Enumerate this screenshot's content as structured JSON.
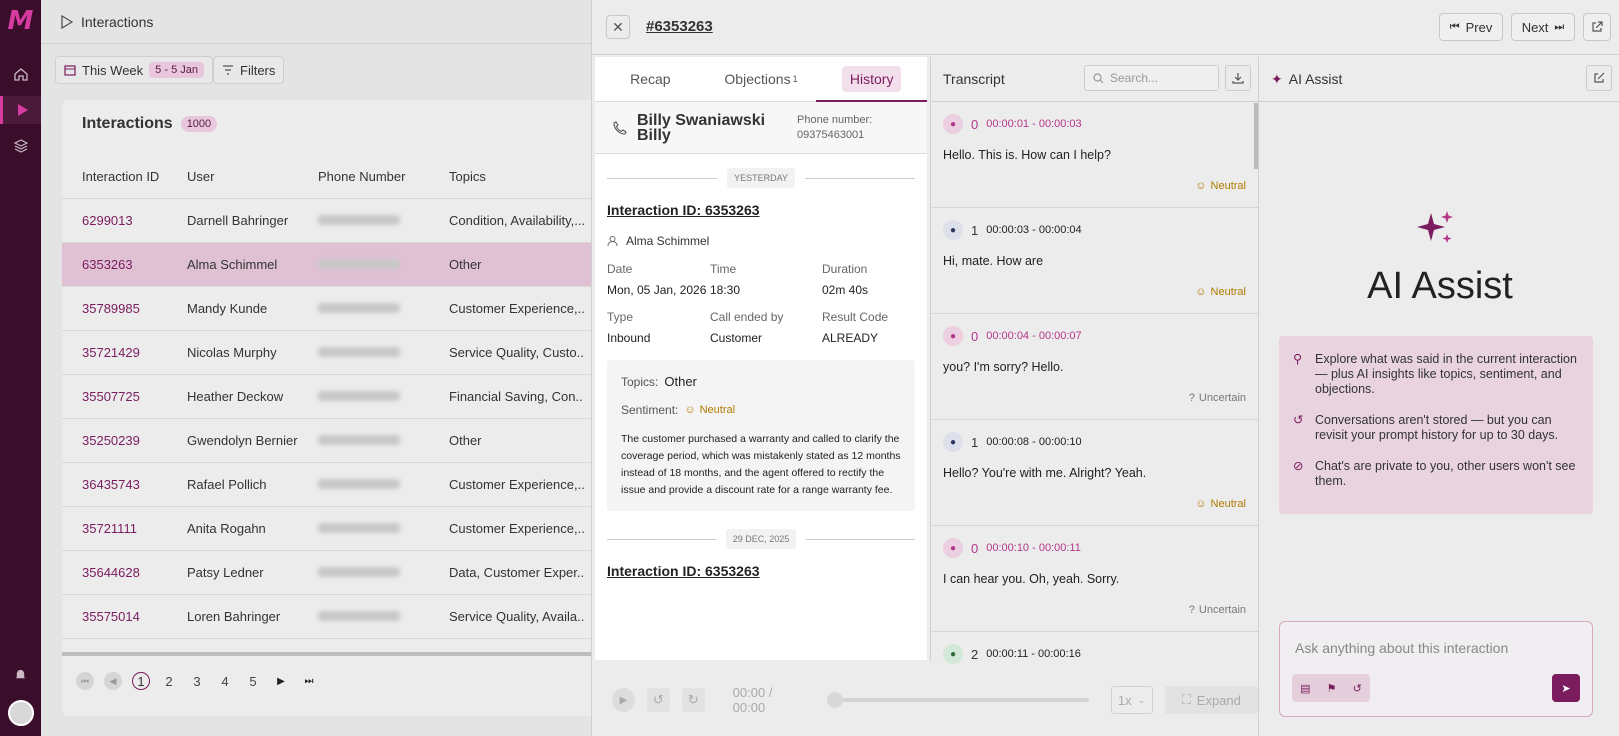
{
  "sidebar": {
    "logo": "M"
  },
  "left": {
    "breadcrumb": "Interactions",
    "filter": {
      "week_label": "This Week",
      "range": "5 - 5 Jan",
      "filters_label": "Filters"
    },
    "card_title": "Interactions",
    "count": "1000",
    "columns": [
      "Interaction ID",
      "User",
      "Phone Number",
      "Topics"
    ],
    "rows": [
      {
        "id": "6299013",
        "user": "Darnell Bahringer",
        "topics": "Condition, Availability,..."
      },
      {
        "id": "6353263",
        "user": "Alma Schimmel",
        "topics": "Other"
      },
      {
        "id": "35789985",
        "user": "Mandy Kunde",
        "topics": "Customer Experience,.."
      },
      {
        "id": "35721429",
        "user": "Nicolas Murphy",
        "topics": "Service Quality, Custo.."
      },
      {
        "id": "35507725",
        "user": "Heather Deckow",
        "topics": "Financial Saving, Con.."
      },
      {
        "id": "35250239",
        "user": "Gwendolyn Bernier",
        "topics": "Other"
      },
      {
        "id": "36435743",
        "user": "Rafael Pollich",
        "topics": "Customer Experience,.."
      },
      {
        "id": "35721111",
        "user": "Anita Rogahn",
        "topics": "Customer Experience,.."
      },
      {
        "id": "35644628",
        "user": "Patsy Ledner",
        "topics": "Data, Customer Exper.."
      },
      {
        "id": "35575014",
        "user": "Loren Bahringer",
        "topics": "Service Quality, Availa.."
      }
    ],
    "pages": [
      "1",
      "2",
      "3",
      "4",
      "5"
    ]
  },
  "panel": {
    "title": "#6353263",
    "prev": "Prev",
    "next": "Next",
    "tabs": [
      "Recap",
      "Objections",
      "History"
    ],
    "objections_count": "1",
    "person": {
      "name": "Billy Swaniawski Billy",
      "phone_label": "Phone number:",
      "phone": "09375463001"
    },
    "day1": "YESTERDAY",
    "interaction1": {
      "link": "Interaction ID: 6353263",
      "agent": "Alma Schimmel",
      "date_label": "Date",
      "date": "Mon, 05 Jan, 2026",
      "time_label": "Time",
      "time": "18:30",
      "duration_label": "Duration",
      "duration": "02m 40s",
      "type_label": "Type",
      "type": "Inbound",
      "ended_label": "Call ended by",
      "ended": "Customer",
      "result_label": "Result Code",
      "result": "ALREADY",
      "topics_label": "Topics:",
      "topics": "Other",
      "sentiment_label": "Sentiment:",
      "sentiment": "Neutral",
      "summary": "The customer purchased a warranty and called to clarify the coverage period, which was mistakenly stated as 12 months instead of 18 months, and the agent offered to rectify the issue and provide a discount rate for a range warranty fee."
    },
    "day2": "29 DEC, 2025",
    "interaction2": {
      "link": "Interaction ID: 6353263"
    }
  },
  "transcript": {
    "title": "Transcript",
    "search_placeholder": "Search...",
    "utterances": [
      {
        "speaker": "0",
        "time": "00:00:01 - 00:00:03",
        "text": "Hello. This is. How can I help?",
        "sentiment": "Neutral"
      },
      {
        "speaker": "1",
        "time": "00:00:03 - 00:00:04",
        "text": "Hi, mate. How are",
        "sentiment": "Neutral"
      },
      {
        "speaker": "0",
        "time": "00:00:04 - 00:00:07",
        "text": "you? I'm sorry? Hello.",
        "sentiment": "Uncertain"
      },
      {
        "speaker": "1",
        "time": "00:00:08 - 00:00:10",
        "text": "Hello? You're with me. Alright? Yeah.",
        "sentiment": "Neutral"
      },
      {
        "speaker": "0",
        "time": "00:00:10 - 00:00:11",
        "text": "I can hear you. Oh, yeah. Sorry.",
        "sentiment": "Uncertain"
      },
      {
        "speaker": "2",
        "time": "00:00:11 - 00:00:16",
        "text": "",
        "sentiment": ""
      }
    ]
  },
  "player": {
    "time": "00:00 / 00:00",
    "speed": "1x",
    "expand": "Expand"
  },
  "ai": {
    "header": "AI Assist",
    "title": "AI Assist",
    "tips": [
      "Explore what was said in the current interaction — plus AI insights like topics, sentiment, and objections.",
      "Conversations aren't stored — but you can revisit your prompt history for up to 30 days.",
      "Chat's are private to you, other users won't see them."
    ],
    "ask_placeholder": "Ask anything about this interaction"
  }
}
